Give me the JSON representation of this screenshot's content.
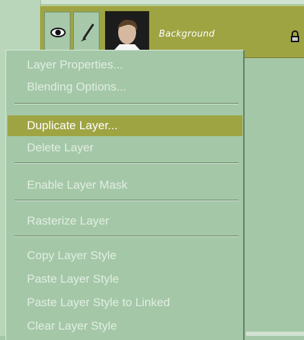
{
  "layer": {
    "name": "Background",
    "visibility_icon": "eye-icon",
    "brush_icon": "brush-icon",
    "lock_icon": "lock-icon",
    "thumbnail": "layer-thumbnail"
  },
  "menu": {
    "items": [
      {
        "label": "Layer Properties...",
        "state": "disabled"
      },
      {
        "label": "Blending Options...",
        "state": "disabled"
      },
      {
        "label": "Duplicate Layer...",
        "state": "highlighted"
      },
      {
        "label": "Delete Layer",
        "state": "disabled"
      },
      {
        "label": "Enable Layer Mask",
        "state": "disabled"
      },
      {
        "label": "Rasterize Layer",
        "state": "disabled"
      },
      {
        "label": "Copy Layer Style",
        "state": "disabled"
      },
      {
        "label": "Paste Layer Style",
        "state": "disabled"
      },
      {
        "label": "Paste Layer Style to Linked",
        "state": "disabled"
      },
      {
        "label": "Clear Layer Style",
        "state": "disabled"
      }
    ]
  },
  "colors": {
    "accent": "#9fa443",
    "panel": "#a4c8a7"
  }
}
